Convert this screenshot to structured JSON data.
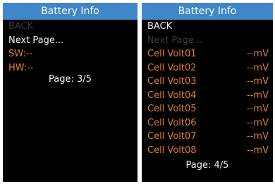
{
  "colors": {
    "title_bar": "#3f87c9",
    "background": "#000000",
    "selected_text": "#f2f2f2",
    "disabled_text": "#3a3a3a",
    "value_text": "#e07f2a"
  },
  "left": {
    "title": "Battery Info",
    "back_label": "BACK",
    "next_label": "Next Page...",
    "sw_label": "SW:--",
    "hw_label": "HW:--",
    "page_indicator": "Page: 3/5"
  },
  "right": {
    "title": "Battery Info",
    "back_label": "BACK",
    "next_label": "Next Page...",
    "cells": [
      {
        "label": "Cell Volt01",
        "value": "--mV"
      },
      {
        "label": "Cell Volt02",
        "value": "--mV"
      },
      {
        "label": "Cell Volt03",
        "value": "--mV"
      },
      {
        "label": "Cell Volt04",
        "value": "--mV"
      },
      {
        "label": "Cell Volt05",
        "value": "--mV"
      },
      {
        "label": "Cell Volt06",
        "value": "--mV"
      },
      {
        "label": "Cell Volt07",
        "value": "--mV"
      },
      {
        "label": "Cell Volt08",
        "value": "--mV"
      }
    ],
    "page_indicator": "Page: 4/5"
  }
}
